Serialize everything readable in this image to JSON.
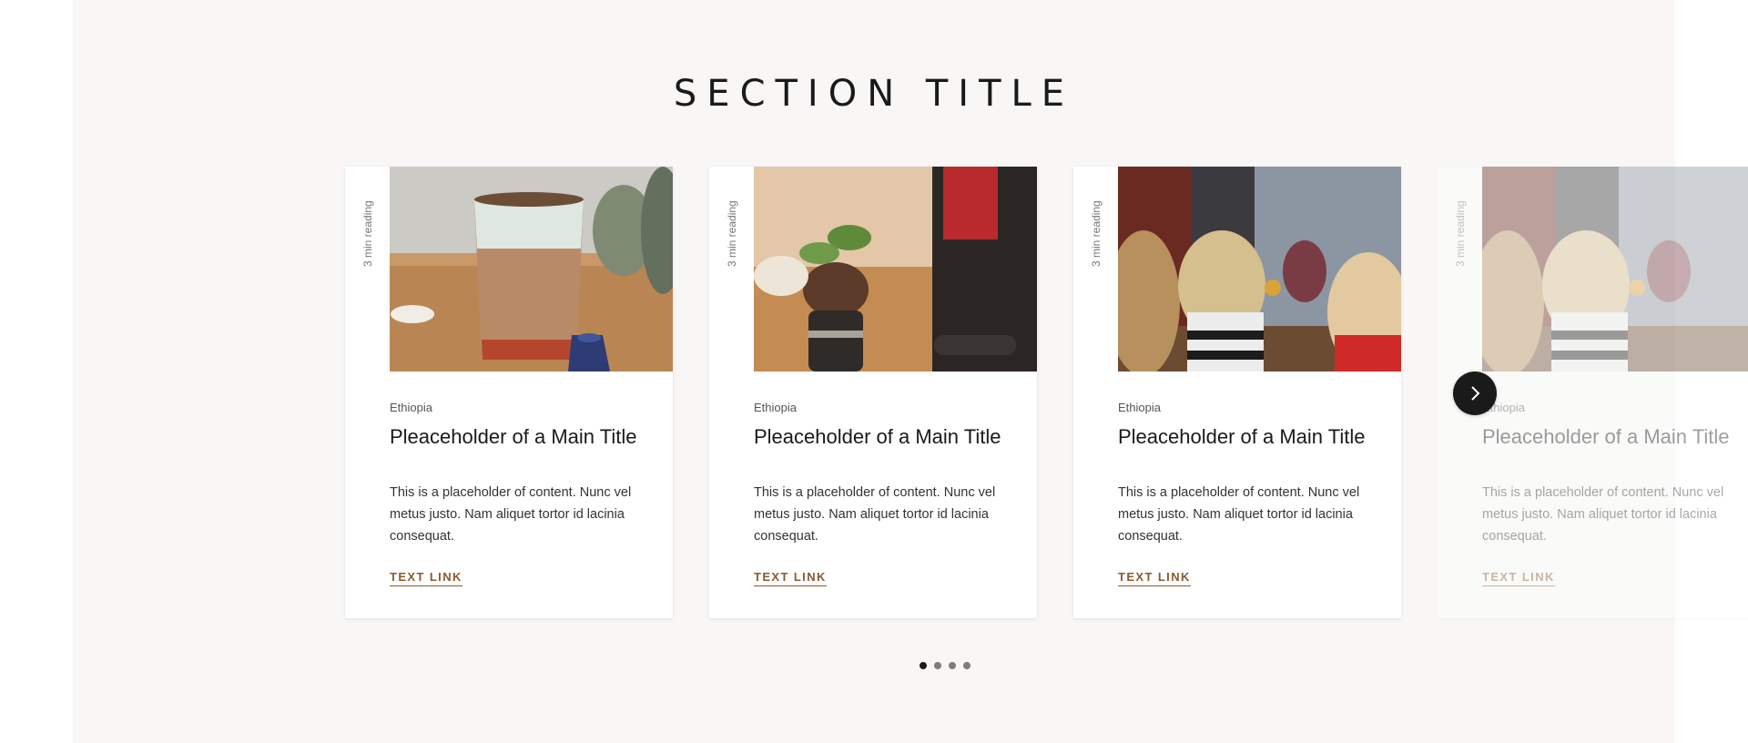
{
  "section": {
    "title": "SECTION TITLE"
  },
  "cards": [
    {
      "reading": "3 min reading",
      "origin": "Ethiopia",
      "title": "Pleaceholder of a Main Title",
      "body": "This is a placeholder of content.  Nunc vel metus justo. Nam aliquet tortor id lacinia consequat.",
      "link": "TEXT LINK"
    },
    {
      "reading": "3 min reading",
      "origin": "Ethiopia",
      "title": "Pleaceholder of a Main Title",
      "body": "This is a placeholder of content.  Nunc vel metus justo. Nam aliquet tortor id lacinia consequat.",
      "link": "TEXT LINK"
    },
    {
      "reading": "3 min reading",
      "origin": "Ethiopia",
      "title": "Pleaceholder of a Main Title",
      "body": "This is a placeholder of content.  Nunc vel metus justo. Nam aliquet tortor id lacinia consequat.",
      "link": "TEXT LINK"
    },
    {
      "reading": "3 min reading",
      "origin": "Ethiopia",
      "title": "Pleaceholder of a Main Title",
      "body": "This is a placeholder of content.  Nunc vel metus justo. Nam aliquet tortor id lacinia consequat.",
      "link": "TEXT LINK"
    }
  ],
  "carousel": {
    "next_icon": "chevron-right-icon",
    "pages": 4,
    "active_page": 1
  },
  "colors": {
    "link": "#8a5a2e",
    "section_bg": "#f8f7f6",
    "button": "#1a1a1a"
  }
}
